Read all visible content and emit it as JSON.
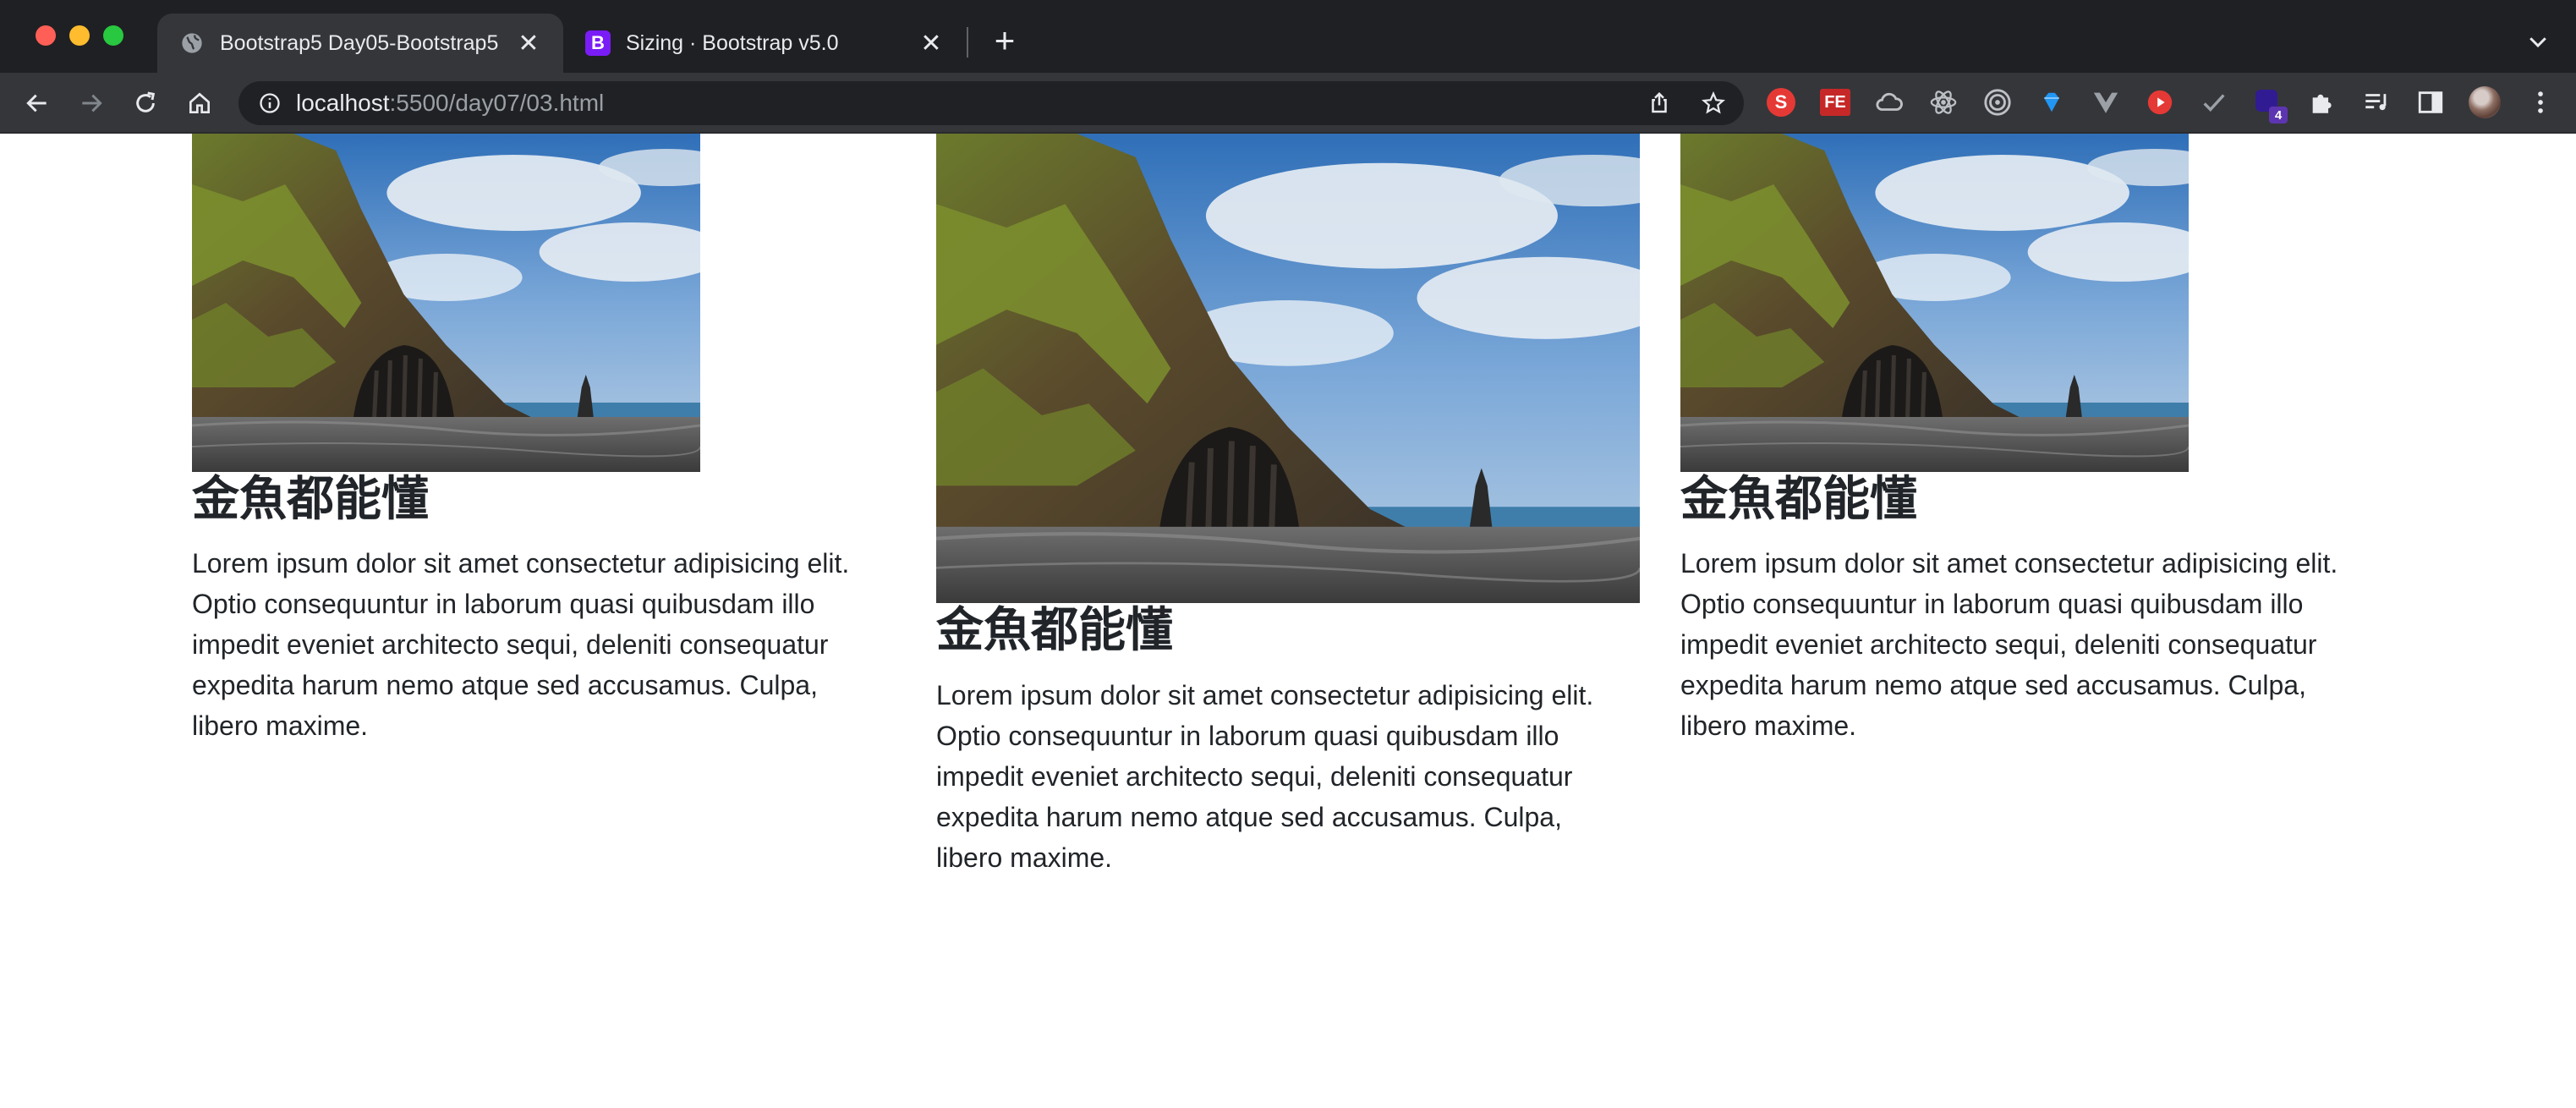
{
  "browser": {
    "tabs": [
      {
        "title": "Bootstrap5 Day05-Bootstrap5",
        "favicon": "globe-icon",
        "active": true
      },
      {
        "title": "Sizing · Bootstrap v5.0",
        "favicon": "bootstrap-icon",
        "favicon_letter": "B",
        "active": false
      }
    ],
    "address": {
      "host": "localhost",
      "path": ":5500/day07/03.html"
    },
    "extensions": [
      {
        "name": "s-extension-icon",
        "label": "S",
        "color": "#e53935"
      },
      {
        "name": "fe-extension-icon",
        "label": "FE",
        "color": "#e53935"
      },
      {
        "name": "cloud-extension-icon",
        "label": "",
        "color": "#bdc1c6"
      },
      {
        "name": "react-devtools-icon",
        "label": "",
        "color": "#bdc1c6"
      },
      {
        "name": "target-extension-icon",
        "label": "",
        "color": "#bdc1c6"
      },
      {
        "name": "gem-extension-icon",
        "label": "",
        "color": "#2196f3"
      },
      {
        "name": "vue-devtools-icon",
        "label": "",
        "color": "#9aa0a6"
      },
      {
        "name": "youtube-extension-icon",
        "label": "",
        "color": "#e53935"
      },
      {
        "name": "checkmark-extension-icon",
        "label": "",
        "color": "#9aa0a6"
      },
      {
        "name": "badge-extension-icon",
        "label": "4",
        "color": "#5e35b1"
      },
      {
        "name": "extensions-puzzle-icon",
        "label": "",
        "color": "#e8eaed"
      },
      {
        "name": "reading-list-icon",
        "label": "",
        "color": "#e8eaed"
      },
      {
        "name": "side-panel-icon",
        "label": "",
        "color": "#e8eaed"
      },
      {
        "name": "profile-avatar",
        "label": "",
        "color": "#9aa0a6"
      },
      {
        "name": "more-menu-icon",
        "label": "",
        "color": "#e8eaed"
      }
    ]
  },
  "cards": [
    {
      "heading": "金魚都能懂",
      "text": "Lorem ipsum dolor sit amet consectetur adipisicing elit. Optio consequuntur in laborum quasi quibusdam illo impedit eveniet architecto sequi, deleniti consequatur expedita harum nemo atque sed accusamus. Culpa, libero maxime."
    },
    {
      "heading": "金魚都能懂",
      "text": "Lorem ipsum dolor sit amet consectetur adipisicing elit. Optio consequuntur in laborum quasi quibusdam illo impedit eveniet architecto sequi, deleniti consequatur expedita harum nemo atque sed accusamus. Culpa, libero maxime."
    },
    {
      "heading": "金魚都能懂",
      "text": "Lorem ipsum dolor sit amet consectetur adipisicing elit. Optio consequuntur in laborum quasi quibusdam illo impedit eveniet architecto sequi, deleniti consequatur expedita harum nemo atque sed accusamus. Culpa, libero maxime."
    }
  ]
}
